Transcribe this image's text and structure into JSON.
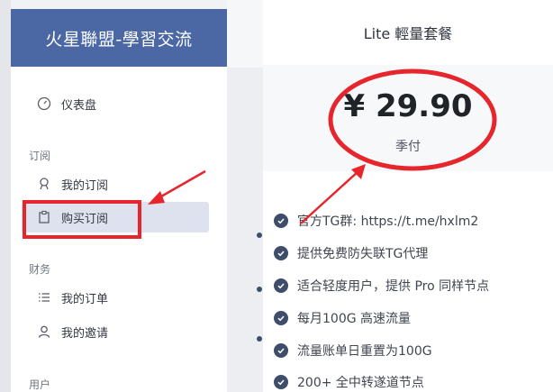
{
  "brand": {
    "title": "火星聯盟-學習交流"
  },
  "sidebar": {
    "dashboard": {
      "label": "仪表盘",
      "icon": "gauge-icon"
    },
    "sections": {
      "subscription": "订阅",
      "finance": "财务",
      "user": "用户"
    },
    "items": {
      "my_subscription": {
        "label": "我的订阅",
        "icon": "subscription-icon"
      },
      "buy_subscription": {
        "label": "购买订阅",
        "icon": "clipboard-icon"
      },
      "my_orders": {
        "label": "我的订单",
        "icon": "list-icon"
      },
      "my_invites": {
        "label": "我的邀请",
        "icon": "invite-icon"
      }
    }
  },
  "plan": {
    "name": "Lite 輕量套餐",
    "price": "¥ 29.90",
    "period": "季付",
    "features": [
      "官方TG群: https://t.me/hxlm2",
      "提供免费防失联TG代理",
      "适合轻度用户，提供 Pro 同样节点",
      "每月100G 高速流量",
      "流量账单日重置为100G",
      "200+ 全中转遂道节点"
    ]
  },
  "colors": {
    "brand_bg": "#4b68a5",
    "annotation_red": "#e6262c",
    "check_bg": "#3e4d6a",
    "active_bg": "#dde2ee"
  }
}
